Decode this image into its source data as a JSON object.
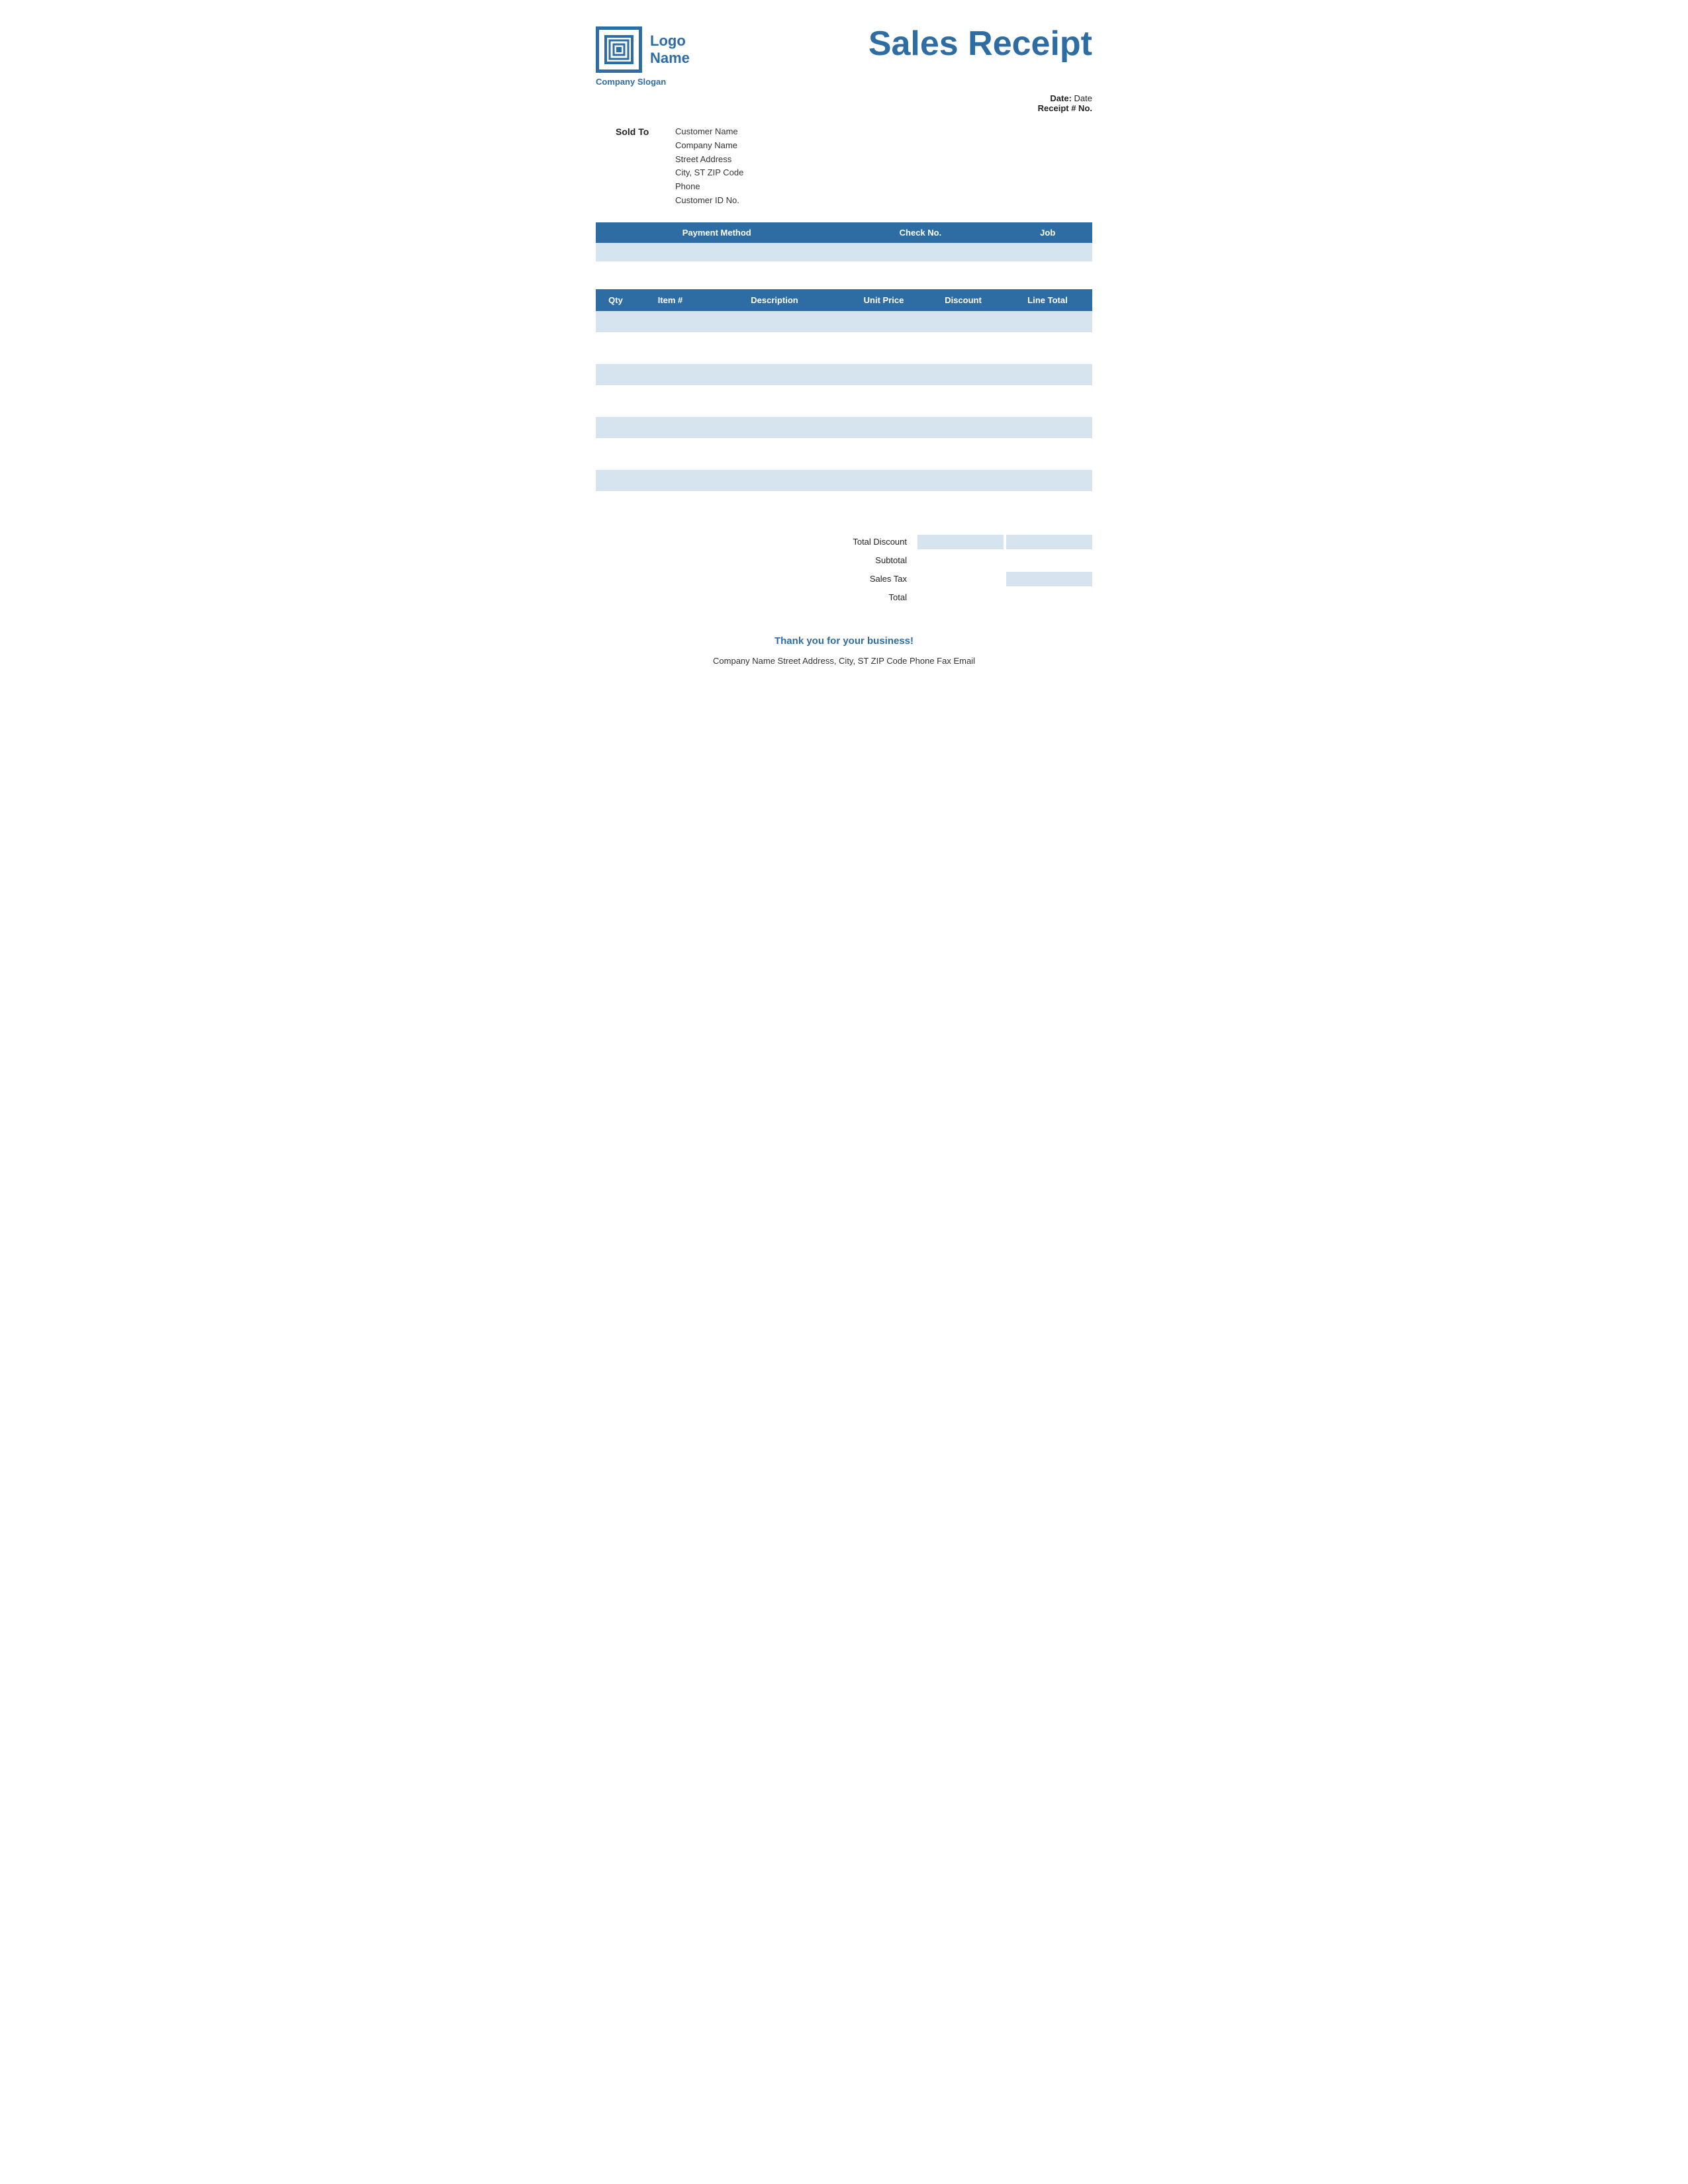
{
  "logo": {
    "name": "Logo\nName",
    "line1": "Logo",
    "line2": "Name"
  },
  "company": {
    "slogan": "Company Slogan",
    "footer": "Company Name   Street Address, City, ST  ZIP Code   Phone   Fax   Email"
  },
  "receipt": {
    "title": "Sales Receipt",
    "date_label": "Date:",
    "date_value": "Date",
    "receipt_label": "Receipt # No."
  },
  "sold_to": {
    "label": "Sold To",
    "customer_name": "Customer Name",
    "company_name": "Company Name",
    "street": "Street Address",
    "city": "City, ST  ZIP Code",
    "phone": "Phone",
    "customer_id": "Customer ID No."
  },
  "payment_headers": [
    "Payment Method",
    "Check No.",
    "Job"
  ],
  "items_headers": [
    "Qty",
    "Item #",
    "Description",
    "Unit Price",
    "Discount",
    "Line Total"
  ],
  "totals": {
    "total_discount": "Total Discount",
    "subtotal": "Subtotal",
    "sales_tax": "Sales Tax",
    "total": "Total"
  },
  "footer": {
    "thank_you": "Thank you for your business!"
  }
}
